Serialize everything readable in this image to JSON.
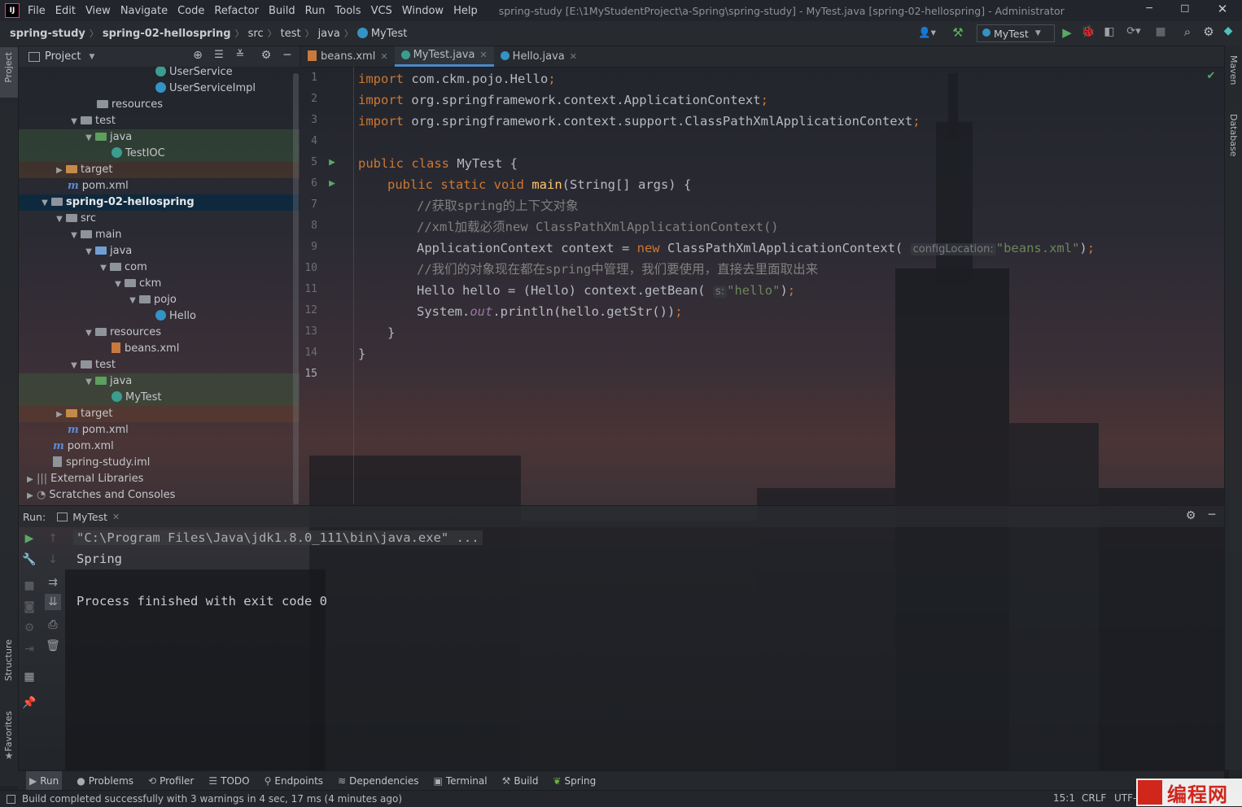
{
  "app": {
    "logo": "IJ",
    "menu": [
      "File",
      "Edit",
      "View",
      "Navigate",
      "Code",
      "Refactor",
      "Build",
      "Run",
      "Tools",
      "VCS",
      "Window",
      "Help"
    ],
    "title": "spring-study [E:\\1MyStudentProject\\a-Spring\\spring-study] - MyTest.java [spring-02-hellospring] - Administrator"
  },
  "breadcrumb": [
    "spring-study",
    "spring-02-hellospring",
    "src",
    "test",
    "java",
    "MyTest"
  ],
  "toolbar": {
    "run_config": "MyTest"
  },
  "left_strip": {
    "project": "Project",
    "structure": "Structure",
    "favorites": "Favorites"
  },
  "right_strip": {
    "maven": "Maven",
    "database": "Database"
  },
  "project_panel": {
    "title": "Project",
    "tree": [
      {
        "label": "UserService",
        "icon": "interface-icon"
      },
      {
        "label": "UserServiceImpl",
        "icon": "class-icon"
      },
      {
        "label": "resources",
        "icon": "folder-icon"
      },
      {
        "label": "test",
        "icon": "folder-icon"
      },
      {
        "label": "java",
        "icon": "folder-icon"
      },
      {
        "label": "TestIOC",
        "icon": "class-icon"
      },
      {
        "label": "target",
        "icon": "folder-icon"
      },
      {
        "label": "pom.xml",
        "icon": "maven-icon"
      },
      {
        "label": "spring-02-hellospring",
        "icon": "module-icon"
      },
      {
        "label": "src",
        "icon": "folder-icon"
      },
      {
        "label": "main",
        "icon": "folder-icon"
      },
      {
        "label": "java",
        "icon": "folder-icon"
      },
      {
        "label": "com",
        "icon": "package-icon"
      },
      {
        "label": "ckm",
        "icon": "package-icon"
      },
      {
        "label": "pojo",
        "icon": "package-icon"
      },
      {
        "label": "Hello",
        "icon": "class-icon"
      },
      {
        "label": "resources",
        "icon": "folder-icon"
      },
      {
        "label": "beans.xml",
        "icon": "xml-icon"
      },
      {
        "label": "test",
        "icon": "folder-icon"
      },
      {
        "label": "java",
        "icon": "folder-icon"
      },
      {
        "label": "MyTest",
        "icon": "class-icon"
      },
      {
        "label": "target",
        "icon": "folder-icon"
      },
      {
        "label": "pom.xml",
        "icon": "maven-icon"
      },
      {
        "label": "pom.xml",
        "icon": "maven-icon"
      },
      {
        "label": "spring-study.iml",
        "icon": "iml-icon"
      },
      {
        "label": "External Libraries",
        "icon": "library-icon"
      },
      {
        "label": "Scratches and Consoles",
        "icon": "scratch-icon"
      }
    ]
  },
  "editor": {
    "tabs": [
      "beans.xml",
      "MyTest.java",
      "Hello.java"
    ],
    "active_tab": "MyTest.java",
    "line_numbers": [
      "1",
      "2",
      "3",
      "4",
      "5",
      "6",
      "7",
      "8",
      "9",
      "10",
      "11",
      "12",
      "13",
      "14",
      "15"
    ],
    "code": {
      "l1_kw": "import",
      "l1_rest": " com.ckm.pojo.Hello",
      "l2_kw": "import",
      "l2_rest": " org.springframework.context.ApplicationContext",
      "l3_kw": "import",
      "l3_rest": " org.springframework.context.support.ClassPathXmlApplicationContext",
      "semicolon": ";",
      "l5_kw": "public class",
      "l5_rest": " MyTest {",
      "l6_kw": "public static void",
      "l6_fn": "main",
      "l6_rest": "(String[] args) {",
      "l7_cm": "//获取spring的上下文对象",
      "l8_cm": "//xml加载必须new ClassPathXmlApplicationContext()",
      "l9_a": "ApplicationContext context = ",
      "l9_new": "new",
      "l9_b": " ClassPathXmlApplicationContext(",
      "l9_hint": "configLocation:",
      "l9_str": "\"beans.xml\"",
      "l9_end": ")",
      "l10_cm": "//我们的对象现在都在spring中管理，我们要使用，直接去里面取出来",
      "l11_a": "Hello hello = (Hello) context.getBean(",
      "l11_hint": "s:",
      "l11_str": "\"hello\"",
      "l11_end": ")",
      "l12_a": "System.",
      "l12_out": "out",
      "l12_b": ".println(hello.getStr())",
      "l13": "}",
      "l14": "}"
    }
  },
  "run_panel": {
    "label": "Run:",
    "tab": "MyTest",
    "lines": [
      "\"C:\\Program Files\\Java\\jdk1.8.0_111\\bin\\java.exe\" ...",
      "Spring",
      "",
      "Process finished with exit code 0"
    ]
  },
  "bottom_tabs": [
    "Run",
    "Problems",
    "Profiler",
    "TODO",
    "Endpoints",
    "Dependencies",
    "Terminal",
    "Build",
    "Spring"
  ],
  "status": {
    "message": "Build completed successfully with 3 warnings in 4 sec, 17 ms (4 minutes ago)",
    "position": "15:1",
    "line_sep": "CRLF",
    "encoding": "UTF-"
  },
  "watermark": {
    "text": "编程网"
  },
  "colors": {
    "keyword": "#cc7832",
    "function": "#ffc66d",
    "string": "#6a8759",
    "comment": "#808080",
    "static_field": "#9876aa",
    "accent": "#4a88c7"
  }
}
